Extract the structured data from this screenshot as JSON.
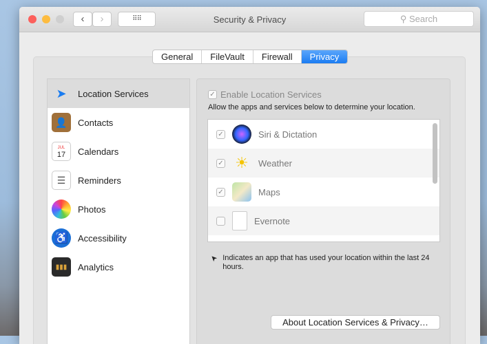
{
  "window": {
    "title": "Security & Privacy",
    "search_placeholder": "Search"
  },
  "tabs": [
    "General",
    "FileVault",
    "Firewall",
    "Privacy"
  ],
  "sidebar": [
    {
      "label": "Location Services",
      "icon": "location-arrow-icon"
    },
    {
      "label": "Contacts",
      "icon": "contacts-icon"
    },
    {
      "label": "Calendars",
      "icon": "calendar-icon",
      "badge_month": "JUL",
      "badge_day": "17"
    },
    {
      "label": "Reminders",
      "icon": "reminders-icon"
    },
    {
      "label": "Photos",
      "icon": "photos-icon"
    },
    {
      "label": "Accessibility",
      "icon": "accessibility-icon"
    },
    {
      "label": "Analytics",
      "icon": "analytics-icon"
    }
  ],
  "panel": {
    "enable_label": "Enable Location Services",
    "allow_text": "Allow the apps and services below to determine your location.",
    "apps": [
      {
        "name": "Siri & Dictation",
        "checked": true
      },
      {
        "name": "Weather",
        "checked": true
      },
      {
        "name": "Maps",
        "checked": true
      },
      {
        "name": "Evernote",
        "checked": false
      }
    ],
    "note": "Indicates an app that has used your location within the last 24 hours.",
    "about_button": "About Location Services & Privacy…"
  }
}
